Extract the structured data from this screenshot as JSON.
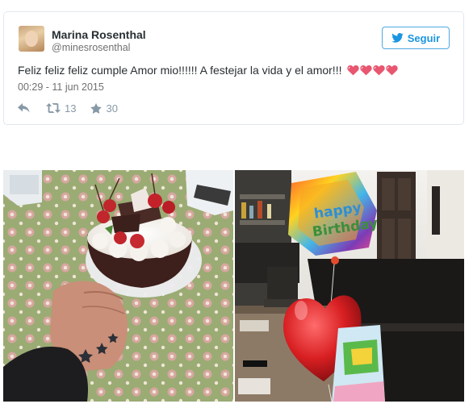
{
  "tweet": {
    "author_name": "Marina Rosenthal",
    "author_handle": "@minesrosenthal",
    "follow_label": "Seguir",
    "text": "Feliz feliz feliz cumple Amor mio!!!!!! A festejar la vida y el amor!!!",
    "emoji": [
      "pink-heart",
      "pink-heart",
      "pink-heart",
      "pink-heart"
    ],
    "timestamp": "00:29 - 11 jun 2015",
    "retweets": "13",
    "likes": "30"
  },
  "balloon_text": {
    "line1": "happy",
    "line2": "Birthday"
  },
  "colors": {
    "accent": "#1b95e0",
    "muted": "#8899a6",
    "heart": "#e8566f"
  }
}
